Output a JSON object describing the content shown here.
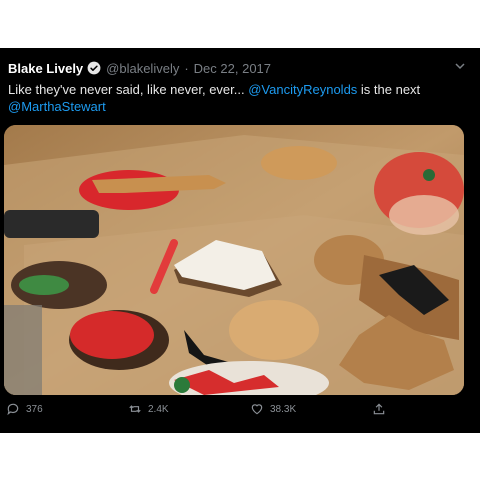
{
  "tweet": {
    "author_name": "Blake Lively",
    "handle": "@blakelively",
    "separator": "·",
    "date": "Dec 22, 2017",
    "text_before": "Like they've never said, like never, ever... ",
    "mention_1": "@VancityReynolds",
    "text_middle": " is the next ",
    "mention_2": "@MarthaStewart",
    "image_description_icons": [
      "verified-badge-icon",
      "chevron-down-icon"
    ]
  },
  "actions": {
    "reply_count": "376",
    "retweet_count": "2.4K",
    "like_count": "38.3K"
  },
  "colors": {
    "background": "#000000",
    "link": "#1d9bf0",
    "muted": "#7a7f85"
  }
}
